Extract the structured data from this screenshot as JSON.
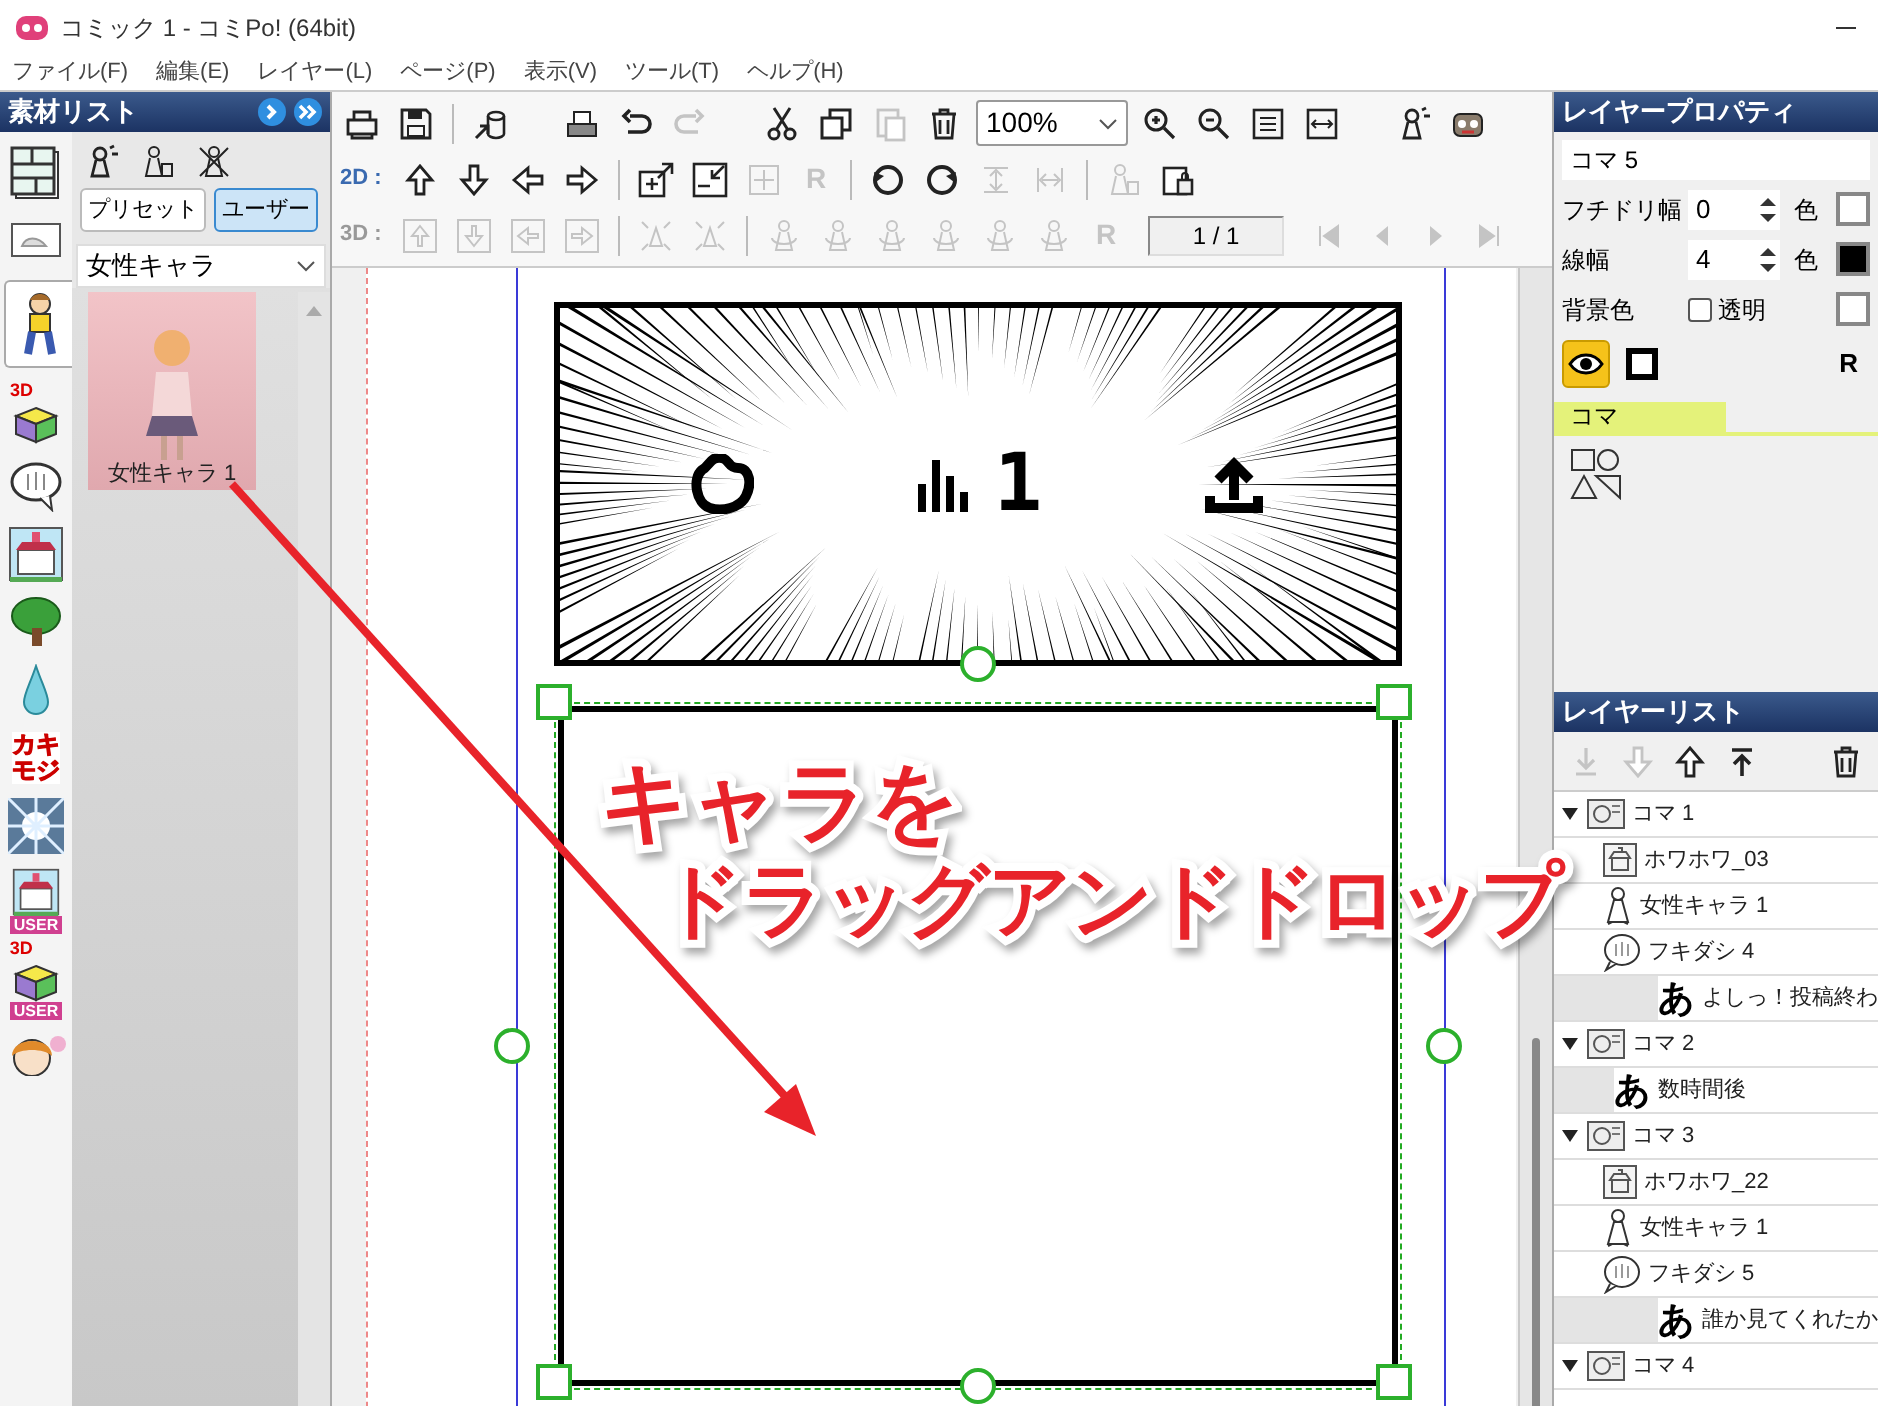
{
  "window": {
    "title": "コミック 1 - コミPo! (64bit)"
  },
  "menu": [
    "ファイル(F)",
    "編集(E)",
    "レイヤー(L)",
    "ページ(P)",
    "表示(V)",
    "ツール(T)",
    "ヘルプ(H)"
  ],
  "material_list": {
    "title": "素材リスト",
    "side_tabs": [
      {
        "kind": "layout",
        "selected": false
      },
      {
        "kind": "scene",
        "selected": false
      },
      {
        "kind": "character",
        "selected": true
      },
      {
        "kind": "cube",
        "badge": "3D",
        "selected": false
      },
      {
        "kind": "balloon",
        "selected": false
      },
      {
        "kind": "building",
        "selected": false
      },
      {
        "kind": "tree",
        "selected": false
      },
      {
        "kind": "drop",
        "selected": false
      },
      {
        "kind": "lettering",
        "lines": [
          "カキ",
          "モジ"
        ],
        "selected": false
      },
      {
        "kind": "burst",
        "selected": false
      },
      {
        "kind": "building",
        "tag": "USER",
        "selected": false
      },
      {
        "kind": "cube",
        "badge": "3D",
        "tag": "USER",
        "selected": false
      },
      {
        "kind": "face",
        "selected": false
      }
    ],
    "filters": [
      {
        "label": "プリセット",
        "selected": false
      },
      {
        "label": "ユーザー",
        "selected": true
      }
    ],
    "category": "女性キャラ",
    "items": [
      {
        "label": "女性キャラ 1"
      }
    ]
  },
  "toolbar": {
    "rows": [
      {
        "items": [
          {
            "kind": "folder",
            "disabled": false
          },
          {
            "kind": "save",
            "disabled": false
          },
          {
            "kind": "separator"
          },
          {
            "kind": "export",
            "disabled": false
          },
          {
            "kind": "gap"
          },
          {
            "kind": "print",
            "disabled": false
          },
          {
            "kind": "undo",
            "disabled": false
          },
          {
            "kind": "redo",
            "disabled": true
          },
          {
            "kind": "gap"
          },
          {
            "kind": "cut",
            "disabled": false
          },
          {
            "kind": "copy",
            "disabled": false
          },
          {
            "kind": "paste",
            "disabled": true
          },
          {
            "kind": "trash",
            "disabled": false
          },
          {
            "kind": "zoom-select",
            "value": "100%"
          },
          {
            "kind": "zoom-in",
            "disabled": false
          },
          {
            "kind": "zoom-out",
            "disabled": false
          },
          {
            "kind": "fit-page",
            "disabled": false
          },
          {
            "kind": "fit-width",
            "disabled": false
          },
          {
            "kind": "gap"
          },
          {
            "kind": "light-figure",
            "disabled": false
          },
          {
            "kind": "robot",
            "disabled": false
          }
        ]
      },
      {
        "label": "2D :",
        "disabled": false,
        "items": [
          {
            "kind": "up",
            "disabled": false
          },
          {
            "kind": "down",
            "disabled": false
          },
          {
            "kind": "left",
            "disabled": false
          },
          {
            "kind": "right",
            "disabled": false
          },
          {
            "kind": "separator"
          },
          {
            "kind": "enlarge",
            "disabled": false
          },
          {
            "kind": "shrink",
            "disabled": false
          },
          {
            "kind": "crosshair",
            "disabled": true
          },
          {
            "kind": "letter",
            "glyph": "R",
            "disabled": true
          },
          {
            "kind": "separator"
          },
          {
            "kind": "rotate-left",
            "disabled": false
          },
          {
            "kind": "rotate-right",
            "disabled": false
          },
          {
            "kind": "flip-v",
            "disabled": true
          },
          {
            "kind": "flip-h",
            "disabled": true
          },
          {
            "kind": "separator"
          },
          {
            "kind": "figure-lock",
            "disabled": true
          },
          {
            "kind": "clipboard-lock",
            "disabled": false
          }
        ]
      },
      {
        "label": "3D :",
        "disabled": true,
        "items": [
          {
            "kind": "box-up",
            "disabled": true
          },
          {
            "kind": "box-down",
            "disabled": true
          },
          {
            "kind": "box-left",
            "disabled": true
          },
          {
            "kind": "box-right",
            "disabled": true
          },
          {
            "kind": "separator"
          },
          {
            "kind": "spread",
            "disabled": true
          },
          {
            "kind": "spread",
            "disabled": true
          },
          {
            "kind": "separator"
          },
          {
            "kind": "figure",
            "disabled": true
          },
          {
            "kind": "figure",
            "disabled": true
          },
          {
            "kind": "figure",
            "disabled": true
          },
          {
            "kind": "figure",
            "disabled": true
          },
          {
            "kind": "figure",
            "disabled": true
          },
          {
            "kind": "figure",
            "disabled": true
          },
          {
            "kind": "letter",
            "glyph": "R",
            "disabled": true
          },
          {
            "kind": "page-field",
            "value": "1 / 1"
          },
          {
            "kind": "first",
            "disabled": true
          },
          {
            "kind": "prev",
            "disabled": true
          },
          {
            "kind": "next",
            "disabled": true
          },
          {
            "kind": "last",
            "disabled": true
          }
        ]
      }
    ]
  },
  "canvas": {
    "panels": [
      {
        "kind": "speed-lines",
        "count": "1",
        "selected": false
      },
      {
        "kind": "blank",
        "selected": true
      }
    ],
    "callout": [
      "キャラを",
      "ドラッグアンドドロップ"
    ]
  },
  "layer_properties": {
    "title": "レイヤープロパティ",
    "name": "コマ 5",
    "fields": [
      {
        "kind": "spinner",
        "label": "フチドリ幅",
        "value": "0",
        "color_label": "色",
        "color": "#ffffff"
      },
      {
        "kind": "spinner",
        "label": "線幅",
        "value": "4",
        "color_label": "色",
        "color": "#000000"
      },
      {
        "kind": "checkbox",
        "label": "背景色",
        "option": "透明",
        "checked": false,
        "color": "#ffffff"
      }
    ],
    "visible": true,
    "outline": true,
    "glyph": "R",
    "tab": "コマ"
  },
  "layer_list": {
    "title": "レイヤーリスト",
    "tools": [
      {
        "kind": "bottom",
        "disabled": true
      },
      {
        "kind": "down",
        "disabled": true
      },
      {
        "kind": "up",
        "disabled": false
      },
      {
        "kind": "top",
        "disabled": false
      },
      {
        "kind": "trash",
        "disabled": false
      }
    ],
    "layers": [
      {
        "kind": "panel",
        "label": "コマ 1",
        "expanded": true,
        "children": [
          {
            "kind": "scene",
            "label": "ホワホワ_03"
          },
          {
            "kind": "character",
            "label": "女性キャラ 1"
          },
          {
            "kind": "balloon",
            "label": "フキダシ 4",
            "children": [
              {
                "kind": "text",
                "glyph": "あ",
                "label": "よしっ！投稿終わ"
              }
            ]
          }
        ]
      },
      {
        "kind": "panel",
        "label": "コマ 2",
        "expanded": true,
        "children": [
          {
            "kind": "text",
            "glyph": "あ",
            "label": "数時間後"
          }
        ]
      },
      {
        "kind": "panel",
        "label": "コマ 3",
        "expanded": true,
        "children": [
          {
            "kind": "scene",
            "label": "ホワホワ_22"
          },
          {
            "kind": "character",
            "label": "女性キャラ 1"
          },
          {
            "kind": "balloon",
            "label": "フキダシ 5",
            "children": [
              {
                "kind": "text",
                "glyph": "あ",
                "label": "誰か見てくれたか"
              }
            ]
          }
        ]
      },
      {
        "kind": "panel",
        "label": "コマ 4",
        "expanded": true
      }
    ]
  }
}
